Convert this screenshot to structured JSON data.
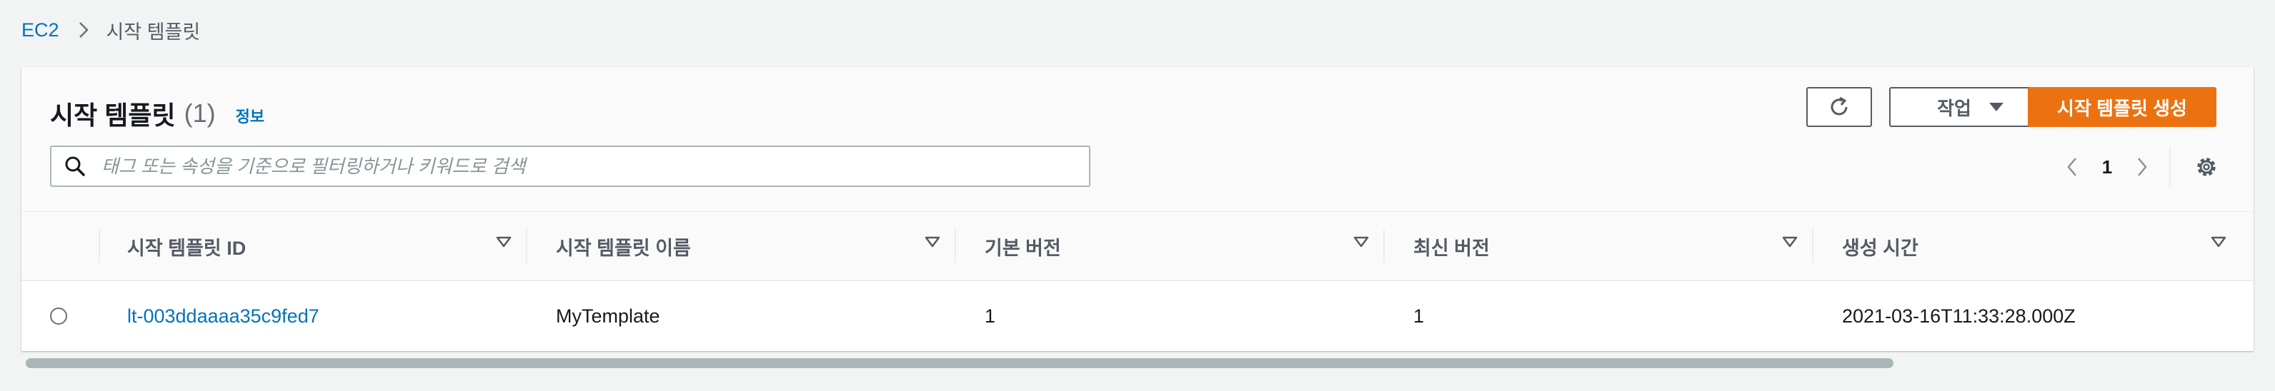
{
  "breadcrumb": {
    "root": "EC2",
    "current": "시작 템플릿"
  },
  "header": {
    "title": "시작 템플릿",
    "count": "(1)",
    "info": "정보",
    "actions_label": "작업",
    "create_label": "시작 템플릿 생성"
  },
  "search": {
    "placeholder": "태그 또는 속성을 기준으로 필터링하거나 키워드로 검색"
  },
  "pagination": {
    "current_page": "1"
  },
  "table": {
    "columns": [
      "시작 템플릿 ID",
      "시작 템플릿 이름",
      "기본 버전",
      "최신 버전",
      "생성 시간"
    ],
    "rows": [
      {
        "id": "lt-003ddaaaa35c9fed7",
        "name": "MyTemplate",
        "default_version": "1",
        "latest_version": "1",
        "created": "2021-03-16T11:33:28.000Z"
      }
    ]
  },
  "scroll": {
    "horizontal_visible_fraction": 0.84
  },
  "colors": {
    "link": "#0073bb",
    "primary": "#ec7211",
    "text": "#16191f",
    "muted": "#545b64"
  },
  "icons": [
    "chevron-right-icon",
    "refresh-icon",
    "caret-down-icon",
    "search-icon",
    "chevron-left-icon",
    "settings-gear-icon",
    "sort-icon"
  ]
}
